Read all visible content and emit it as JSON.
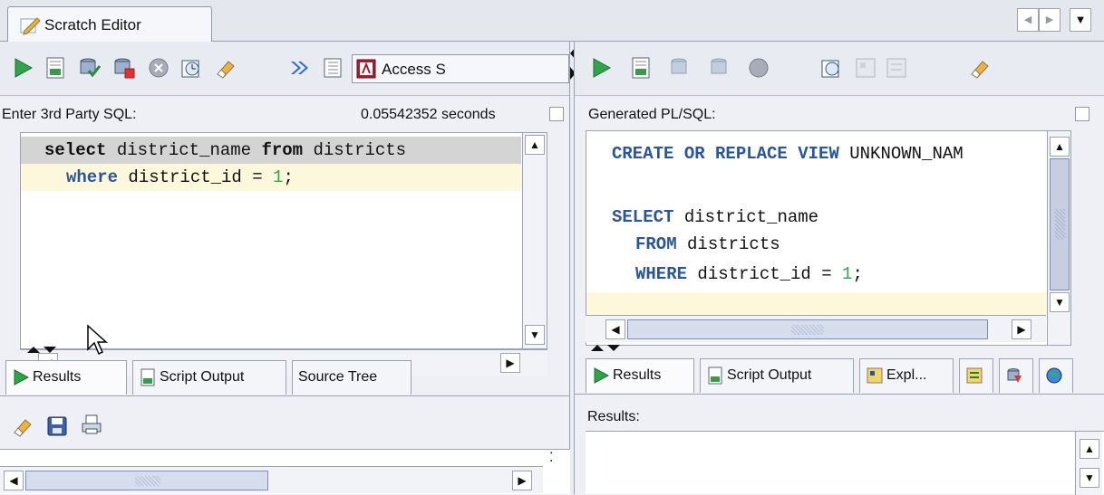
{
  "window": {
    "tab_title": "Scratch Editor"
  },
  "left": {
    "toolbar_dropdown": "Access S",
    "sql_label": "Enter 3rd Party SQL:",
    "elapsed": "0.05542352 seconds",
    "sql_lines": [
      {
        "kw1": "select",
        "t1": " district_name ",
        "kw2": "from",
        "t2": " districts"
      },
      {
        "kw1": "where",
        "t1": " district_id = ",
        "num": "1",
        "t2": ";"
      }
    ],
    "bottom_tabs": [
      "Results",
      "Script Output",
      "Source Tree"
    ],
    "icons": {
      "run": "run-icon",
      "script": "script-icon",
      "commit": "commit-icon",
      "rollback": "rollback-icon",
      "cancel": "cancel-icon",
      "history": "history-icon",
      "clear": "eraser-icon",
      "translate": "double-arrow-icon",
      "grid": "grid-icon",
      "access": "access-icon",
      "save": "save-icon",
      "print": "print-icon"
    }
  },
  "right": {
    "plsql_label": "Generated PL/SQL:",
    "plsql_lines": [
      {
        "kw": "CREATE OR REPLACE VIEW",
        "t": " UNKNOWN_NAM"
      },
      {
        "kw": "",
        "t": ""
      },
      {
        "kw": "SELECT",
        "t": " district_name"
      },
      {
        "kw": "FROM",
        "t": " districts",
        "indent": "  "
      },
      {
        "kw": "WHERE",
        "t": " district_id = ",
        "num": "1",
        "t2": ";",
        "indent": "  "
      }
    ],
    "bottom_tabs": [
      "Results",
      "Script Output",
      "Expl..."
    ],
    "results_label": "Results:"
  },
  "colors": {
    "keyword": "#2a5596",
    "current_line": "#fdf8dc",
    "selected_line": "#d4d4d4",
    "run_green": "#2fa44a"
  }
}
